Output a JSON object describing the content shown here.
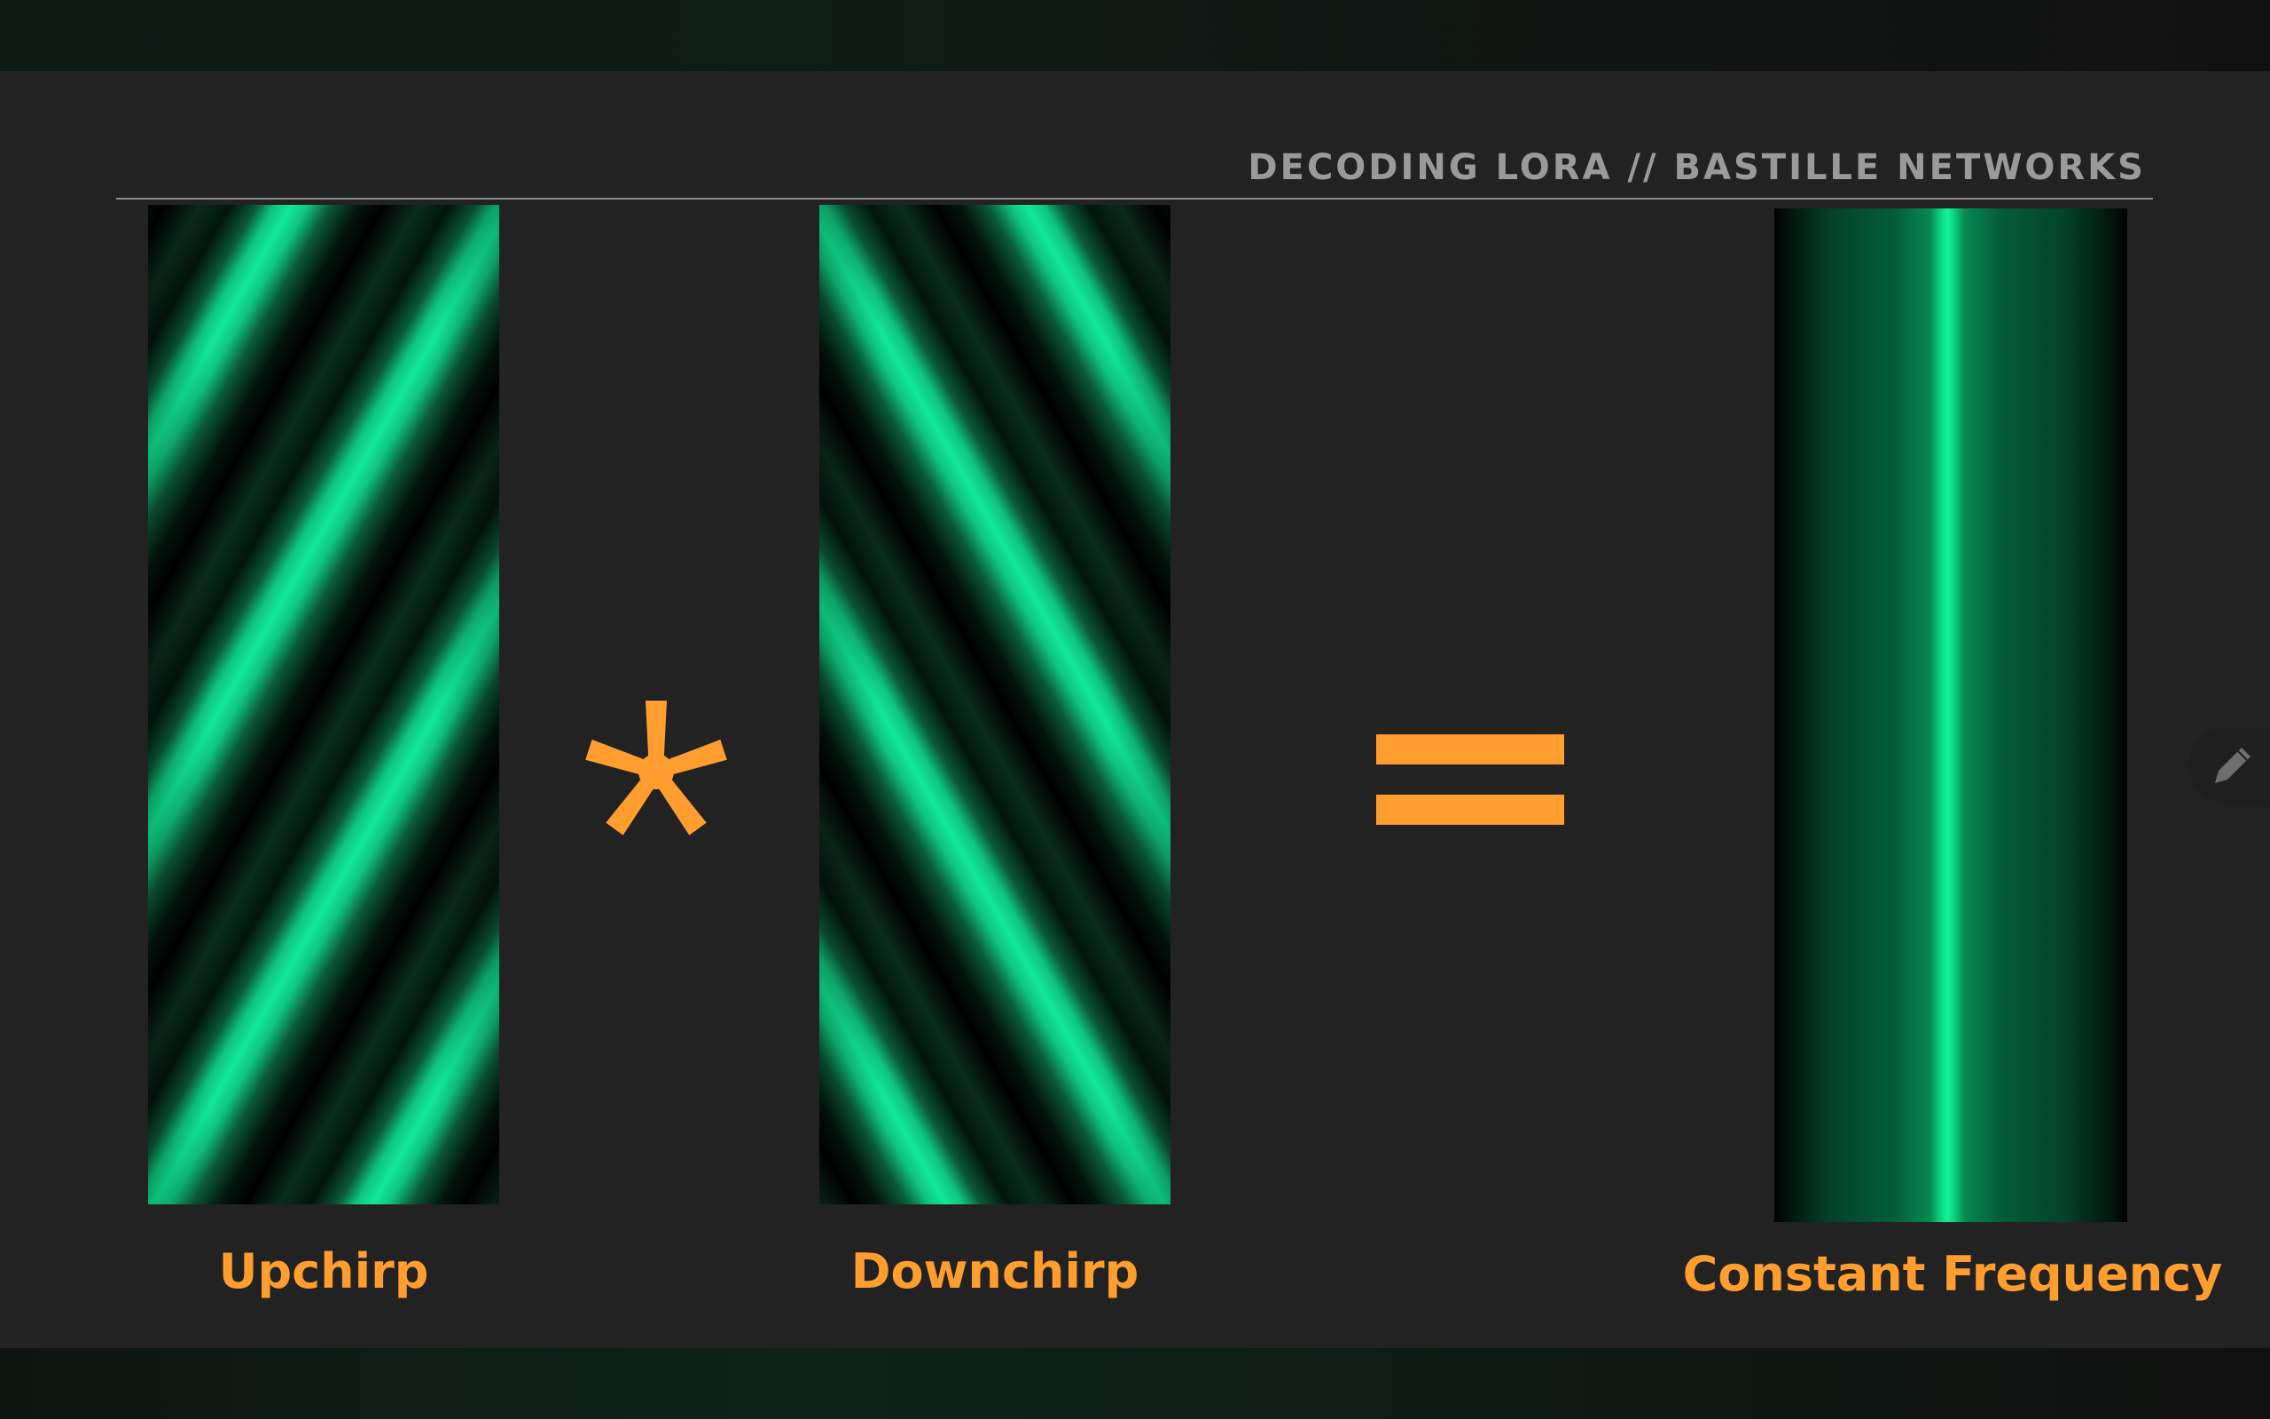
{
  "slide": {
    "header_title": "DECODING LORA // BASTILLE NETWORKS",
    "operators": {
      "multiply_symbol": "*",
      "equals_symbol": "="
    },
    "labels": {
      "upchirp": "Upchirp",
      "downchirp": "Downchirp",
      "constant_frequency": "Constant Frequency"
    }
  },
  "colors": {
    "accent_orange": "#ff9d2f",
    "signal_green": "#12e895",
    "slide_background": "#222222",
    "header_text": "#9a9a9a"
  },
  "icons": {
    "edit": "pencil-icon"
  }
}
